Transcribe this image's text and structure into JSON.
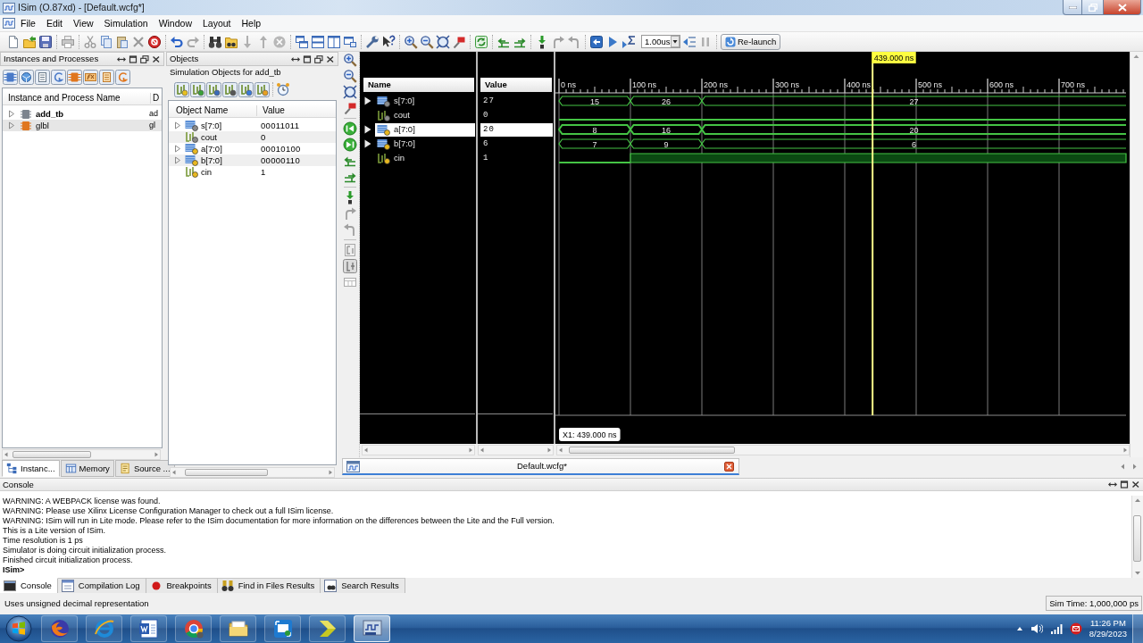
{
  "window": {
    "title": "ISim (O.87xd) - [Default.wcfg*]"
  },
  "menu": [
    {
      "label": "File"
    },
    {
      "label": "Edit"
    },
    {
      "label": "View"
    },
    {
      "label": "Simulation"
    },
    {
      "label": "Window"
    },
    {
      "label": "Layout"
    },
    {
      "label": "Help"
    }
  ],
  "toolbar": {
    "run_time": "1.00us",
    "relaunch": "Re-launch"
  },
  "instances_panel": {
    "title": "Instances and Processes",
    "columns": [
      "Instance and Process Name",
      "D"
    ],
    "rows": [
      {
        "name": "add_tb",
        "column_2": "ad",
        "color": "#7c848e",
        "current": true,
        "expanded": false,
        "selected": false
      },
      {
        "name": "glbl",
        "column_2": "gl",
        "color": "#e0761e",
        "current": false,
        "expanded": false,
        "selected": true
      }
    ],
    "tabs": [
      {
        "label": "Instanc...",
        "selected": true
      },
      {
        "label": "Memory",
        "selected": false
      },
      {
        "label": "Source ...",
        "selected": false
      }
    ]
  },
  "objects_panel": {
    "title": "Objects",
    "subtitle": "Simulation Objects for add_tb",
    "columns": [
      "Object Name",
      "Value"
    ],
    "rows": [
      {
        "name": "s[7:0]",
        "value": "00011011",
        "kind": "bus",
        "output": true
      },
      {
        "name": "cout",
        "value": "0",
        "kind": "bit",
        "output": true
      },
      {
        "name": "a[7:0]",
        "value": "00010100",
        "kind": "bus",
        "output": false
      },
      {
        "name": "b[7:0]",
        "value": "00000110",
        "kind": "bus",
        "output": false
      },
      {
        "name": "cin",
        "value": "1",
        "kind": "bit",
        "output": false
      }
    ]
  },
  "waveform": {
    "columns": [
      "Name",
      "Value"
    ],
    "time_ticks": [
      "0 ns",
      "100 ns",
      "200 ns",
      "300 ns",
      "400 ns",
      "500 ns",
      "600 ns",
      "700 ns"
    ],
    "signals": [
      {
        "name": "s[7:0]",
        "value": "27",
        "kind": "bus",
        "output": true,
        "selected": false,
        "segments": [
          {
            "label": "15"
          },
          {
            "label": "26"
          },
          {
            "label": "27"
          }
        ]
      },
      {
        "name": "cout",
        "value": "0",
        "kind": "bit",
        "output": true,
        "selected": false,
        "segments": [
          {
            "high": false
          }
        ]
      },
      {
        "name": "a[7:0]",
        "value": "20",
        "kind": "bus",
        "output": false,
        "selected": true,
        "segments": [
          {
            "label": "8"
          },
          {
            "label": "16"
          },
          {
            "label": "20"
          }
        ]
      },
      {
        "name": "b[7:0]",
        "value": "6",
        "kind": "bus",
        "output": false,
        "selected": false,
        "segments": [
          {
            "label": "7"
          },
          {
            "label": "9"
          },
          {
            "label": "6"
          }
        ]
      },
      {
        "name": "cin",
        "value": "1",
        "kind": "bit",
        "output": false,
        "selected": false,
        "segments": [
          {
            "high": false
          },
          {
            "high": true
          }
        ]
      }
    ],
    "cursor": {
      "label": "439.000 ns",
      "readout": "X1: 439.000 ns",
      "level": 0.553
    }
  },
  "document_tab": {
    "label": "Default.wcfg*"
  },
  "console": {
    "title": "Console",
    "lines": [
      "WARNING: A WEBPACK license was found.",
      "WARNING: Please use Xilinx License Configuration Manager to check out a full ISim license.",
      "WARNING: ISim will run in Lite mode. Please refer to the ISim documentation for more information on the differences between the Lite and the Full version.",
      "This is a Lite version of ISim.",
      "Time resolution is 1 ps",
      "Simulator is doing circuit initialization process.",
      "Finished circuit initialization process."
    ],
    "prompt": "ISim>",
    "tabs": [
      {
        "label": "Console",
        "selected": true
      },
      {
        "label": "Compilation Log",
        "selected": false
      },
      {
        "label": "Breakpoints",
        "selected": false
      },
      {
        "label": "Find in Files Results",
        "selected": false
      },
      {
        "label": "Search Results",
        "selected": false
      }
    ]
  },
  "status_bar": {
    "message": "Uses unsigned decimal representation",
    "sim_time": "Sim Time: 1,000,000 ps"
  },
  "taskbar": {
    "apps": [
      {
        "selected": false
      },
      {
        "selected": false
      },
      {
        "selected": false
      },
      {
        "selected": false
      },
      {
        "selected": false
      },
      {
        "selected": false
      },
      {
        "selected": false
      },
      {
        "selected": true
      }
    ],
    "time": "11:26 PM",
    "date": "8/29/2023"
  }
}
